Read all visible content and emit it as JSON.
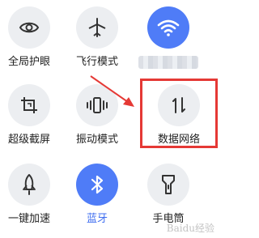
{
  "tiles": [
    {
      "label": "全局护眼",
      "icon": "eye-icon",
      "active": false
    },
    {
      "label": "飞行模式",
      "icon": "airplane-icon",
      "active": false
    },
    {
      "label": "",
      "icon": "wifi-icon",
      "active": true
    },
    {
      "label": "超级截屏",
      "icon": "screenshot-icon",
      "active": false
    },
    {
      "label": "振动模式",
      "icon": "vibrate-icon",
      "active": false
    },
    {
      "label": "数据网络",
      "icon": "mobile-data-icon",
      "active": false
    },
    {
      "label": "一键加速",
      "icon": "rocket-icon",
      "active": false
    },
    {
      "label": "蓝牙",
      "icon": "bluetooth-icon",
      "active": true
    },
    {
      "label": "手电筒",
      "icon": "flashlight-icon",
      "active": false
    }
  ],
  "colors": {
    "active_tile": "#4f7cf7",
    "inactive_tile": "#eceef1",
    "highlight": "#e53935"
  },
  "watermark": "Baidu经验"
}
